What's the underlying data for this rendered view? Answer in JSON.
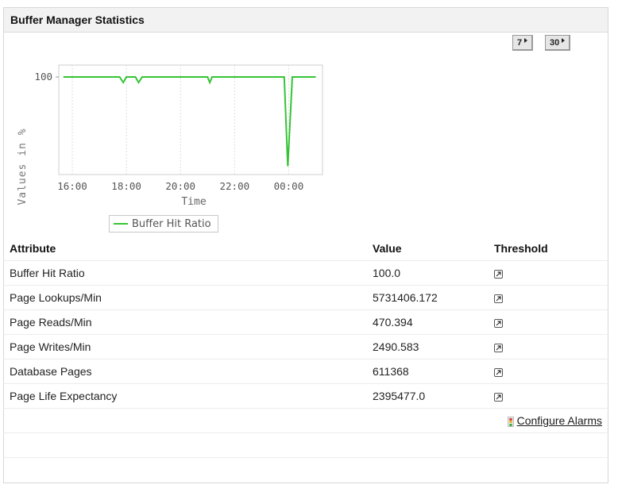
{
  "panel": {
    "title": "Buffer Manager Statistics"
  },
  "period_buttons": [
    {
      "label": "7"
    },
    {
      "label": "30"
    }
  ],
  "chart_data": {
    "type": "line",
    "title": "",
    "xlabel": "Time",
    "ylabel": "Values in %",
    "x_ticks": [
      "16:00",
      "18:00",
      "20:00",
      "22:00",
      "00:00"
    ],
    "y_ticks": [
      "100"
    ],
    "series": [
      {
        "name": "Buffer Hit Ratio",
        "color": "#35c435",
        "x": [
          "15:40",
          "16:00",
          "17:00",
          "17:45",
          "17:53",
          "18:00",
          "18:20",
          "18:27",
          "18:35",
          "19:00",
          "20:00",
          "21:00",
          "21:05",
          "21:10",
          "22:00",
          "23:00",
          "23:50",
          "23:58",
          "24:08",
          "24:20",
          "25:00"
        ],
        "values": [
          100,
          100,
          100,
          100,
          99.9,
          100,
          100,
          99.9,
          100,
          100,
          100,
          100,
          99.9,
          100,
          100,
          100,
          100,
          98.4,
          100,
          100,
          100
        ]
      }
    ],
    "grid": true
  },
  "table": {
    "headers": {
      "attribute": "Attribute",
      "value": "Value",
      "threshold": "Threshold"
    },
    "rows": [
      {
        "attribute": "Buffer Hit Ratio",
        "value": "100.0"
      },
      {
        "attribute": "Page Lookups/Min",
        "value": "5731406.172"
      },
      {
        "attribute": "Page Reads/Min",
        "value": "470.394"
      },
      {
        "attribute": "Page Writes/Min",
        "value": "2490.583"
      },
      {
        "attribute": "Database Pages",
        "value": "611368"
      },
      {
        "attribute": "Page Life Expectancy",
        "value": "2395477.0"
      }
    ],
    "configure_alarms_label": "Configure Alarms"
  }
}
